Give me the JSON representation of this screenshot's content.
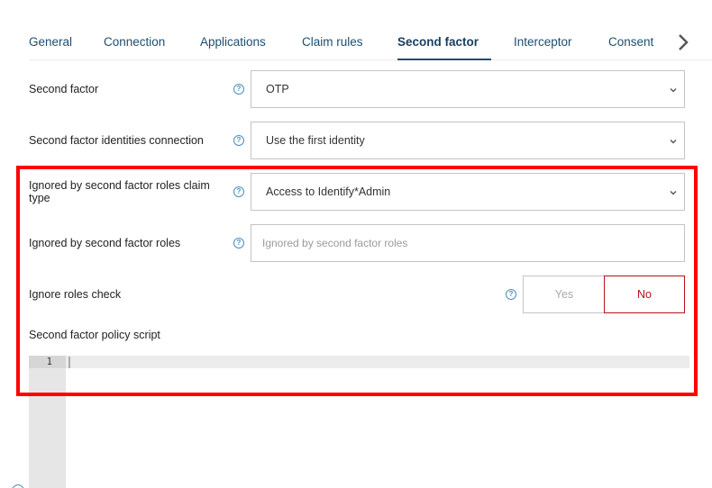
{
  "tabs": [
    {
      "label": "General",
      "active": false
    },
    {
      "label": "Connection",
      "active": false
    },
    {
      "label": "Applications",
      "active": false
    },
    {
      "label": "Claim rules",
      "active": false
    },
    {
      "label": "Second factor",
      "active": true
    },
    {
      "label": "Interceptor",
      "active": false
    },
    {
      "label": "Consent",
      "active": false
    }
  ],
  "tabs_next_icon": "chevron-right-icon",
  "form": {
    "help_glyph": "?",
    "second_factor": {
      "label": "Second factor",
      "value": "OTP"
    },
    "identities_connection": {
      "label": "Second factor identities connection",
      "value": "Use the first identity"
    },
    "ignored_roles_claim_type": {
      "label": "Ignored by second factor roles claim type",
      "value": "Access to Identify*Admin"
    },
    "ignored_roles": {
      "label": "Ignored by second factor roles",
      "value": "",
      "placeholder": "Ignored by second factor roles"
    },
    "ignore_roles_check": {
      "label": "Ignore roles check",
      "yes_label": "Yes",
      "no_label": "No",
      "selected": "No"
    },
    "policy_script": {
      "label": "Second factor policy script",
      "line_numbers": [
        "1"
      ],
      "content": ""
    }
  },
  "colors": {
    "accent": "#1b4d73",
    "selected_toggle": "#b5121b",
    "highlight_box": "#ff0000"
  }
}
